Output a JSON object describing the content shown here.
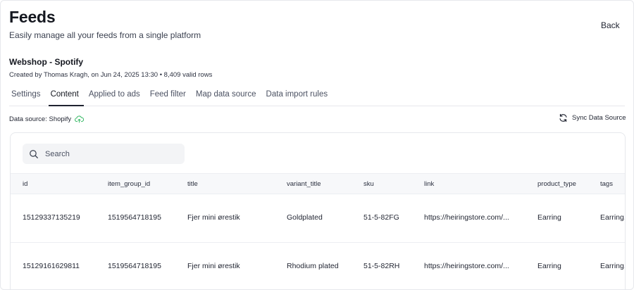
{
  "header": {
    "title": "Feeds",
    "subtitle": "Easily manage all your feeds from a single platform",
    "back_label": "Back"
  },
  "feed": {
    "name": "Webshop - Spotify",
    "meta": "Created by Thomas Kragh, on Jun 24, 2025 13:30 • 8,409 valid rows"
  },
  "tabs": [
    {
      "label": "Settings",
      "active": false
    },
    {
      "label": "Content",
      "active": true
    },
    {
      "label": "Applied to ads",
      "active": false
    },
    {
      "label": "Feed filter",
      "active": false
    },
    {
      "label": "Map data source",
      "active": false
    },
    {
      "label": "Data import rules",
      "active": false
    }
  ],
  "data_source": {
    "label": "Data source: Shopify",
    "icon": "cloud-upload-icon",
    "icon_color": "#3dbb6a"
  },
  "sync": {
    "label": "Sync Data Source",
    "icon": "refresh-icon"
  },
  "search": {
    "placeholder": "Search",
    "value": ""
  },
  "table": {
    "columns": [
      "id",
      "item_group_id",
      "title",
      "variant_title",
      "sku",
      "link",
      "product_type",
      "tags"
    ],
    "rows": [
      [
        "15129337135219",
        "1519564718195",
        "Fjer mini ørestik",
        "Goldplated",
        "51-5-82FG",
        "https://heiringstore.com/...",
        "Earring",
        "Earring,"
      ],
      [
        "15129161629811",
        "1519564718195",
        "Fjer mini ørestik",
        "Rhodium plated",
        "51-5-82RH",
        "https://heiringstore.com/...",
        "Earring",
        "Earring,"
      ]
    ]
  }
}
